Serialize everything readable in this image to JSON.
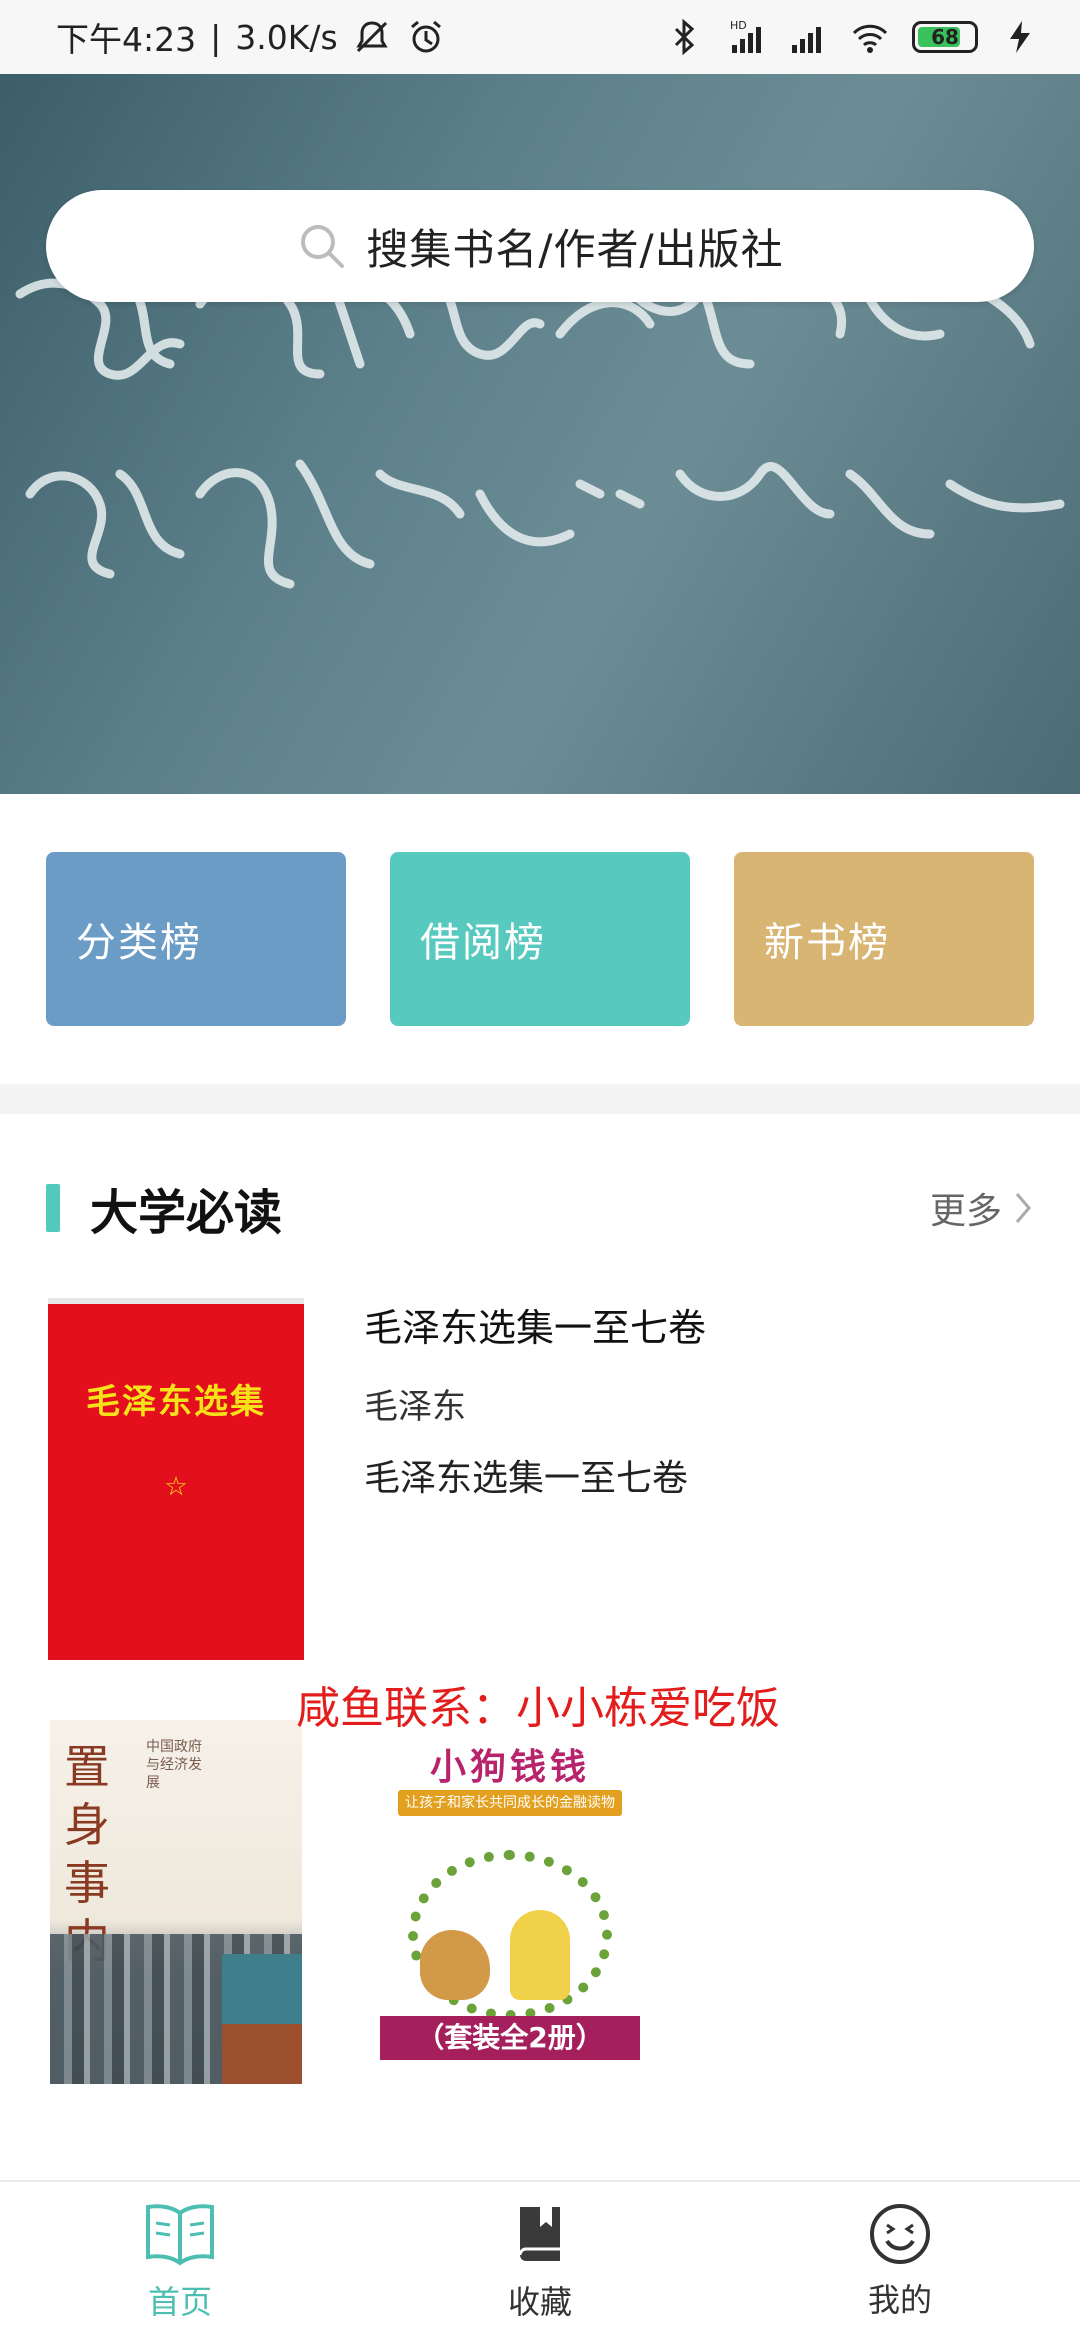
{
  "status_bar": {
    "time": "下午4:23",
    "network_speed": "3.0K/s",
    "battery": "68",
    "signal_hd": "HD",
    "icons": [
      "mute-icon",
      "alarm-icon",
      "bluetooth-icon",
      "signal-icon",
      "signal-icon",
      "wifi-icon",
      "battery-icon",
      "charging-icon"
    ]
  },
  "search": {
    "placeholder": "搜集书名/作者/出版社"
  },
  "rankings": [
    {
      "label": "分类榜",
      "color": "#6b9cc5"
    },
    {
      "label": "借阅榜",
      "color": "#58c9bf"
    },
    {
      "label": "新书榜",
      "color": "#d9b574"
    }
  ],
  "section": {
    "title": "大学必读",
    "more": "更多"
  },
  "featured_book": {
    "title": "毛泽东选集一至七卷",
    "author": "毛泽东",
    "description": "毛泽东选集一至七卷",
    "cover_title": "毛泽东选集"
  },
  "overlay_note": "咸鱼联系：小小栋爱吃饭",
  "book_covers": [
    {
      "title": "置身事内",
      "tagline": "中国政府与经济发展"
    },
    {
      "title": "小狗钱钱",
      "subtitle": "让孩子和家长共同成长的金融读物",
      "band": "（套装全2册）"
    }
  ],
  "bottom_nav": [
    {
      "label": "首页",
      "icon": "book-open-icon",
      "active": true
    },
    {
      "label": "收藏",
      "icon": "bookmark-book-icon",
      "active": false
    },
    {
      "label": "我的",
      "icon": "smiley-icon",
      "active": false
    }
  ],
  "colors": {
    "accent": "#53c8bd",
    "nav_active": "#4dbfb2",
    "note_red": "#e31c1c"
  }
}
